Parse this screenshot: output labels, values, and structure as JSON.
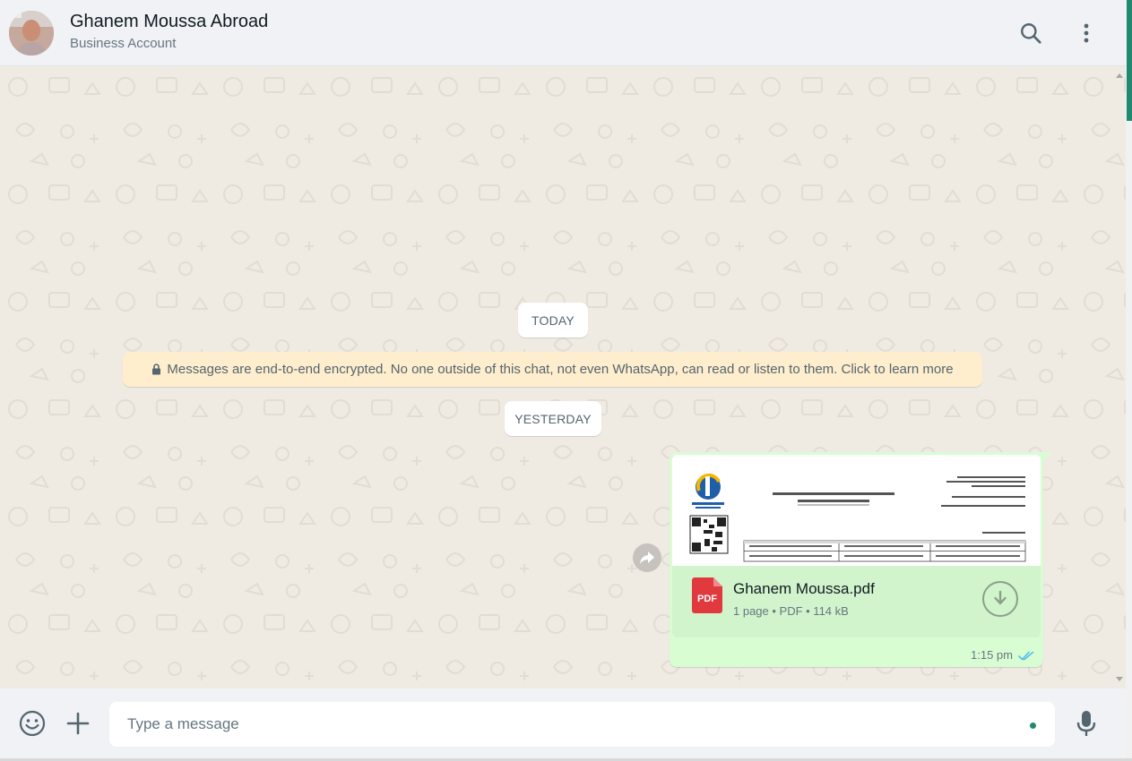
{
  "header": {
    "contact_name": "Ghanem Moussa Abroad",
    "contact_subtitle": "Business Account",
    "icons": [
      "search-icon",
      "more-options-icon"
    ]
  },
  "chat": {
    "date_today": "TODAY",
    "date_yesterday": "YESTERDAY",
    "encryption_notice": "Messages are end-to-end encrypted. No one outside of this chat, not even WhatsApp, can read or listen to them. Click to learn more",
    "message": {
      "file_name": "Ghanem Moussa.pdf",
      "file_meta": "1 page • PDF • 114 kB",
      "file_type_label": "PDF",
      "time": "1:15 pm",
      "status": "read"
    }
  },
  "footer": {
    "input_placeholder": "Type a message",
    "icons": [
      "emoji-icon",
      "attach-plus-icon",
      "microphone-icon"
    ]
  },
  "colors": {
    "header_bg": "#f0f2f5",
    "chat_bg": "#efeae2",
    "outgoing_bubble": "#d9fdd3",
    "encryption_bg": "#ffeecd",
    "pdf_red": "#e0393e",
    "accent": "#1f8a6f",
    "read_ticks": "#53bdeb"
  }
}
